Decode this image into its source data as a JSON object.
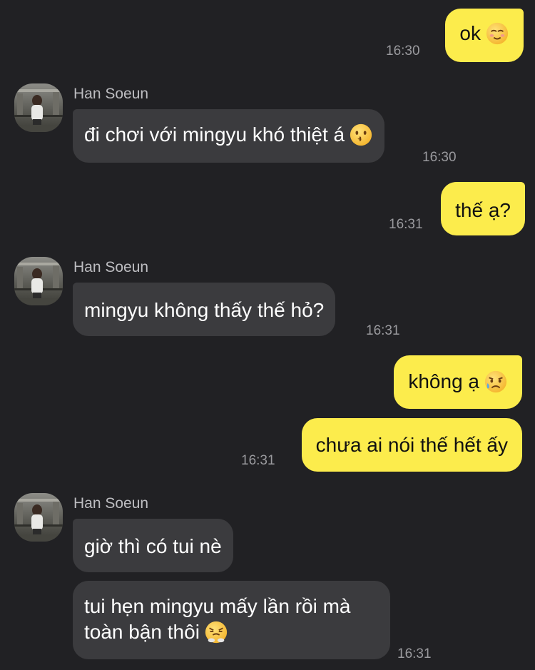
{
  "messages": [
    {
      "text": "ok",
      "time": "16:30",
      "emoji": "relieved-face-emoji"
    },
    {
      "sender": "Han Soeun",
      "text": "đi chơi với mingyu khó thiệt á",
      "time": "16:30",
      "emoji": "kissing-face-emoji"
    },
    {
      "text": "thế ạ?",
      "time": "16:31"
    },
    {
      "sender": "Han Soeun",
      "text": "mingyu không thấy thế hỏ?",
      "time": "16:31"
    },
    {
      "text": "không ạ",
      "emoji": "sad-sweat-face-emoji"
    },
    {
      "text": "chưa ai nói thế hết ấy",
      "time": "16:31"
    },
    {
      "sender": "Han Soeun",
      "text": "giờ thì có tui nè"
    },
    {
      "text": "tui hẹn mingyu mấy lần rồi mà toàn bận thôi",
      "time": "16:31",
      "emoji": "steam-nose-face-emoji"
    }
  ],
  "colors": {
    "background": "#212124",
    "outgoing_bubble": "#fcec4c",
    "incoming_bubble": "#3b3b3e",
    "timestamp": "#9a9a9e"
  }
}
